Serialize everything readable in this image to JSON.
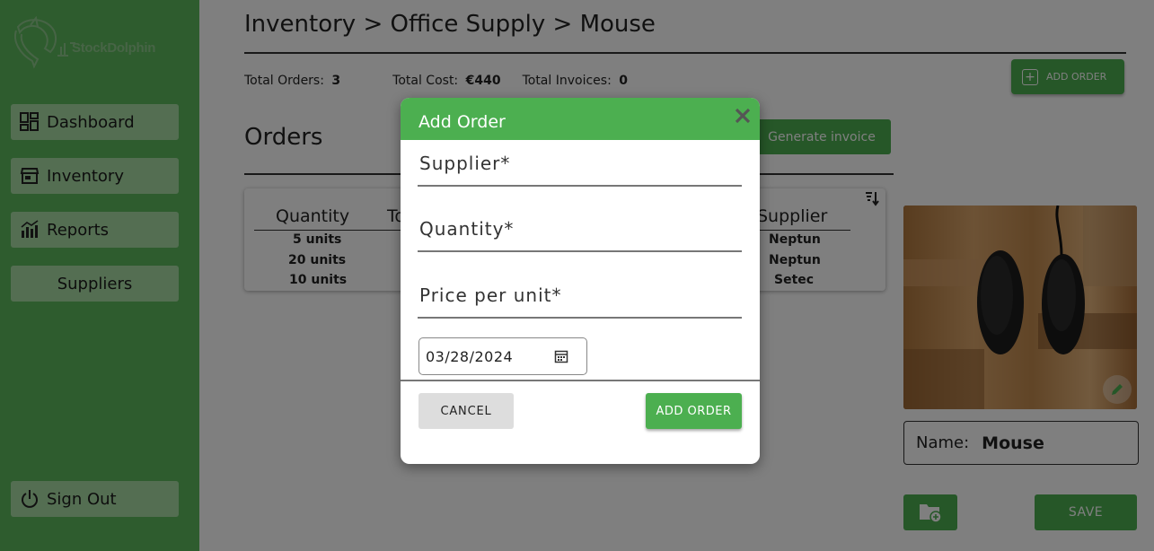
{
  "sidebar": {
    "logo_text": "StockDolphin",
    "items": [
      {
        "label": "Dashboard",
        "icon": "dashboard-icon"
      },
      {
        "label": "Inventory",
        "icon": "inventory-icon"
      },
      {
        "label": "Reports",
        "icon": "reports-icon"
      },
      {
        "label": "Suppliers",
        "icon": ""
      }
    ],
    "signout_label": "Sign Out",
    "signout_icon": "power-icon"
  },
  "header": {
    "breadcrumb": "Inventory > Office Supply > Mouse"
  },
  "stats": {
    "total_orders_label": "Total Orders:",
    "total_orders_value": "3",
    "total_cost_label": "Total Cost:",
    "total_cost_value": "€440",
    "total_invoices_label": "Total Invoices:",
    "total_invoices_value": "0"
  },
  "toolbar": {
    "add_order_label": "ADD ORDER",
    "generate_invoice_label": "Generate invoice"
  },
  "orders": {
    "title": "Orders",
    "columns": [
      "Quantity",
      "To",
      "Supplier"
    ],
    "rows": [
      {
        "quantity": "5 units",
        "supplier": "Neptun"
      },
      {
        "quantity": "20 units",
        "supplier": "Neptun"
      },
      {
        "quantity": "10 units",
        "supplier": "Setec"
      }
    ]
  },
  "product": {
    "name_label": "Name:",
    "name_value": "Mouse",
    "save_label": "SAVE"
  },
  "modal": {
    "title": "Add Order",
    "supplier_label": "Supplier*",
    "quantity_label": "Quantity*",
    "price_label": "Price per unit*",
    "date_value": "03/28/2024",
    "cancel_label": "CANCEL",
    "add_label": "ADD ORDER"
  },
  "colors": {
    "sidebar_green": "#5cb85c",
    "nav_item_bg": "#a9dca5",
    "accent_green": "#4caf50"
  }
}
